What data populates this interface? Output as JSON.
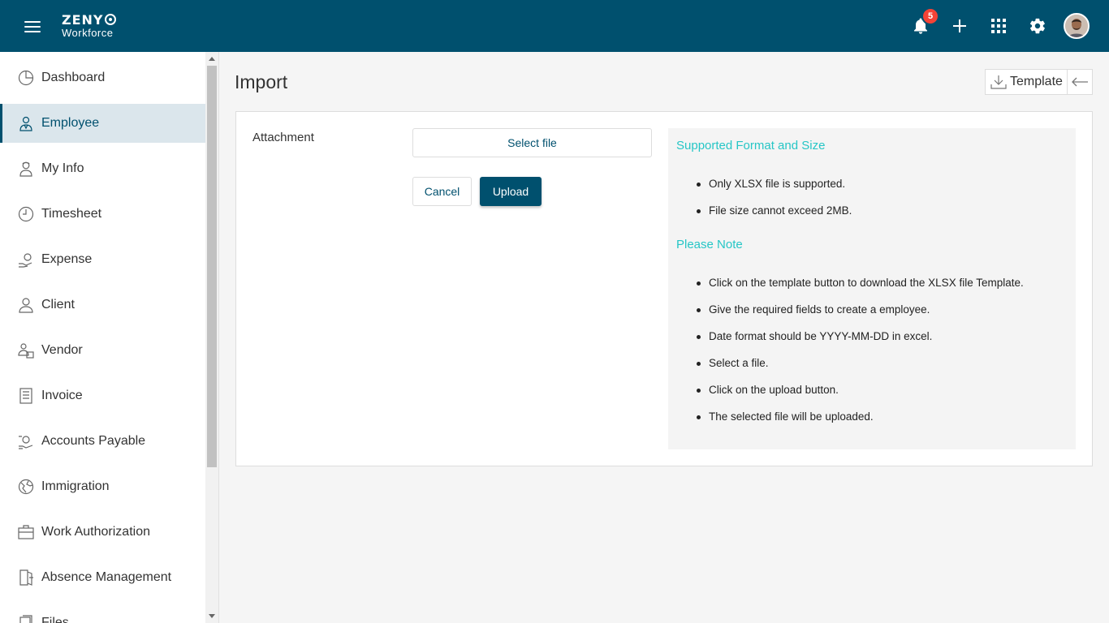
{
  "header": {
    "logo_top": "ZENY",
    "logo_bottom": "Workforce",
    "notification_count": "5",
    "icons": [
      "menu-icon",
      "bell-icon",
      "plus-icon",
      "apps-grid-icon",
      "gear-icon",
      "avatar"
    ]
  },
  "sidebar": {
    "items": [
      {
        "label": "Dashboard",
        "icon": "dashboard-icon",
        "active": false
      },
      {
        "label": "Employee",
        "icon": "employee-icon",
        "active": true
      },
      {
        "label": "My Info",
        "icon": "my-info-icon",
        "active": false
      },
      {
        "label": "Timesheet",
        "icon": "clock-icon",
        "active": false
      },
      {
        "label": "Expense",
        "icon": "expense-icon",
        "active": false
      },
      {
        "label": "Client",
        "icon": "client-icon",
        "active": false
      },
      {
        "label": "Vendor",
        "icon": "vendor-icon",
        "active": false
      },
      {
        "label": "Invoice",
        "icon": "invoice-icon",
        "active": false
      },
      {
        "label": "Accounts Payable",
        "icon": "accounts-payable-icon",
        "active": false
      },
      {
        "label": "Immigration",
        "icon": "globe-icon",
        "active": false
      },
      {
        "label": "Work Authorization",
        "icon": "briefcase-icon",
        "active": false
      },
      {
        "label": "Absence Management",
        "icon": "exit-door-icon",
        "active": false
      },
      {
        "label": "Files",
        "icon": "files-icon",
        "active": false
      }
    ]
  },
  "main": {
    "title": "Import",
    "template_label": "Template",
    "attachment_label": "Attachment",
    "select_file_label": "Select file",
    "cancel_label": "Cancel",
    "upload_label": "Upload",
    "info": {
      "supported_heading": "Supported Format and Size",
      "supported_items": [
        "Only XLSX file is supported.",
        "File size cannot exceed 2MB."
      ],
      "note_heading": "Please Note",
      "note_items": [
        "Click on the template button to download the XLSX file Template.",
        "Give the required fields to create a employee.",
        "Date format should be YYYY-MM-DD in excel.",
        "Select a file.",
        "Click on the upload button.",
        "The selected file will be uploaded."
      ]
    }
  },
  "colors": {
    "header_bg": "#00506e",
    "accent": "#00506e",
    "heading_teal": "#26c6c6",
    "badge_red": "#f44336",
    "logo_orange": "#f28c28"
  }
}
